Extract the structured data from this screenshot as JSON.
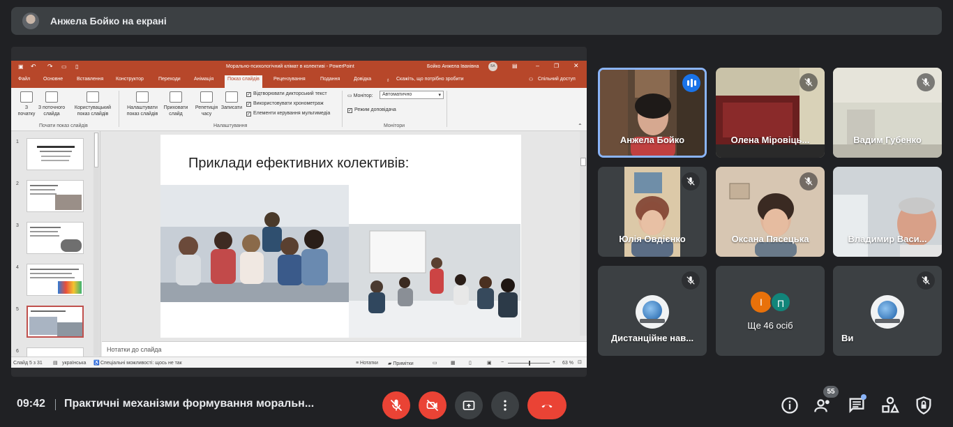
{
  "presenter": {
    "label": "Анжела Бойко на екрані"
  },
  "ppt": {
    "window_title": "Морально-психологічний клімат в колективі - PowerPoint",
    "user": "Бойко Анжела Іванівна",
    "user_initials": "БА",
    "tabs": [
      "Файл",
      "Основне",
      "Вставлення",
      "Конструктор",
      "Переходи",
      "Анімація",
      "Показ слайдів",
      "Рецензування",
      "Подання",
      "Довідка"
    ],
    "active_tab": "Показ слайдів",
    "tell_me": "Скажіть, що потрібно зробити",
    "share": "Спільний доступ",
    "ribbon": {
      "from_start": "З початку",
      "from_current": "З поточного слайда",
      "custom_show": "Користувацький показ слайдів",
      "group_start": "Почати показ слайдів",
      "setup": "Налаштувати показ слайдів",
      "hide": "Приховати слайд",
      "rehearse": "Репетиція часу",
      "record": "Записати",
      "play_narrations": "Відтворювати дикторський текст",
      "use_timings": "Використовувати хронометраж",
      "show_media": "Елементи керування мультимедіа",
      "group_setup": "Налаштування",
      "monitor_label": "Монітор:",
      "monitor_value": "Автоматично",
      "presenter_view": "Режим доповідача",
      "group_monitors": "Монітори"
    },
    "thumbnails": [
      "1",
      "2",
      "3",
      "4",
      "5",
      "6"
    ],
    "slide_title": "Приклади ефективних колективів:",
    "notes_placeholder": "Нотатки до слайда",
    "status": {
      "slide": "Слайд 5 з 31",
      "language": "українська",
      "accessibility": "Спеціальні можливості: щось не так",
      "notes": "Нотатки",
      "comments": "Примітки",
      "zoom": "63 %"
    }
  },
  "participants": [
    {
      "name": "Анжела Бойко",
      "speaking": true
    },
    {
      "name": "Олена Міровіць..."
    },
    {
      "name": "Вадим Губенко"
    },
    {
      "name": "Юлія Овдієнко"
    },
    {
      "name": "Оксана Пясецька"
    },
    {
      "name": "Владимир Васи..."
    },
    {
      "name": "Дистанційне нав..."
    },
    {
      "name": "Ще 46 осіб",
      "initials": [
        "І",
        "П"
      ]
    },
    {
      "name": "Ви"
    }
  ],
  "colors": {
    "accent_speaking": "#8ab4f8",
    "danger": "#ea4335",
    "ppt_brand": "#b7472a",
    "avatar_orange": "#e8710a",
    "avatar_teal": "#12857a"
  },
  "bottom": {
    "time": "09:42",
    "meeting_title": "Практичні механізми формування моральн...",
    "people_count": "55"
  }
}
